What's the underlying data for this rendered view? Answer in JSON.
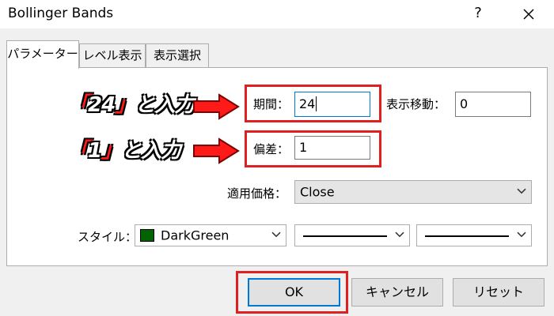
{
  "window": {
    "title": "Bollinger Bands",
    "help_label": "?"
  },
  "tabs": [
    {
      "label": "パラメーター",
      "active": true
    },
    {
      "label": "レベル表示",
      "active": false
    },
    {
      "label": "表示選択",
      "active": false
    }
  ],
  "parameters": {
    "period_label": "期間：",
    "period_value": "24",
    "shift_label": "表示移動：",
    "shift_value": "0",
    "deviation_label": "偏差：",
    "deviation_value": "1",
    "apply_price_label": "適用価格：",
    "apply_price_value": "Close",
    "style_label": "スタイル：",
    "style_color_name": "DarkGreen",
    "style_color_hex": "#006400"
  },
  "annotations": {
    "period_note_num": "24",
    "period_note_suffix": "と入力",
    "deviation_note_num": "1",
    "deviation_note_suffix": "と入力",
    "open_quote": "「",
    "close_quote": "」",
    "highlight_color": "#e02020"
  },
  "buttons": {
    "ok": "OK",
    "cancel": "キャンセル",
    "reset": "リセット"
  }
}
